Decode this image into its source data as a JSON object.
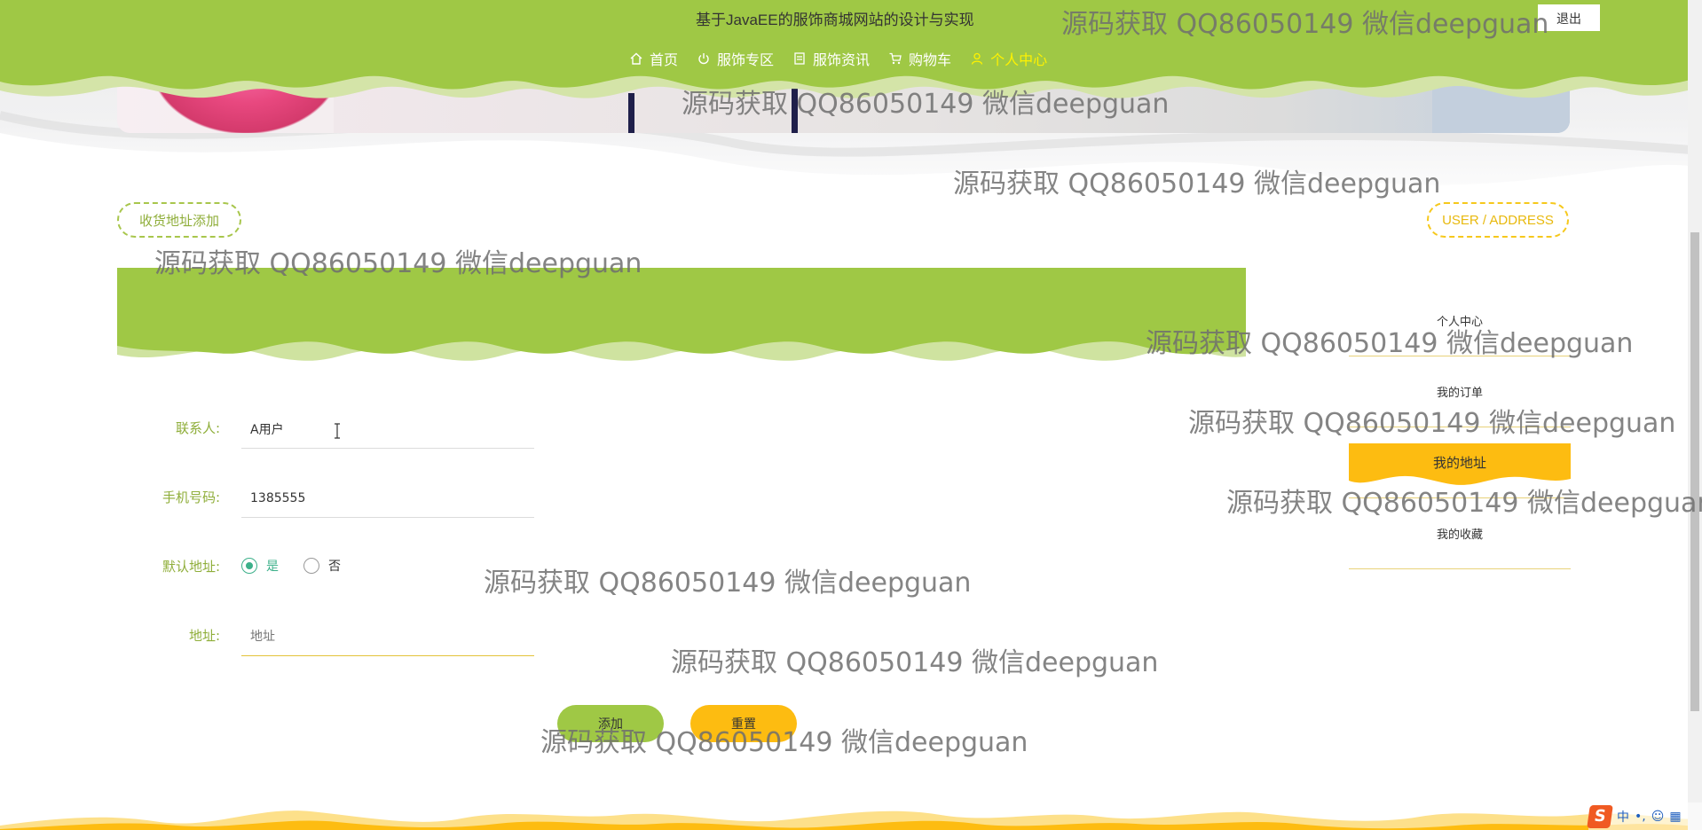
{
  "header": {
    "site_title": "基于JavaEE的服饰商城网站的设计与实现",
    "logout_label": "退出",
    "nav": [
      {
        "label": "首页",
        "icon": "home-icon",
        "active": false
      },
      {
        "label": "服饰专区",
        "icon": "power-icon",
        "active": false
      },
      {
        "label": "服饰资讯",
        "icon": "document-icon",
        "active": false
      },
      {
        "label": "购物车",
        "icon": "cart-icon",
        "active": false
      },
      {
        "label": "个人中心",
        "icon": "user-icon",
        "active": true
      }
    ]
  },
  "section": {
    "title_left": "收货地址添加",
    "title_right": "USER / ADDRESS"
  },
  "form": {
    "contact_label": "联系人:",
    "contact_value": "A用户",
    "phone_label": "手机号码:",
    "phone_value": "1385555",
    "default_label": "默认地址:",
    "default_options": [
      {
        "label": "是",
        "checked": true
      },
      {
        "label": "否",
        "checked": false
      }
    ],
    "address_label": "地址:",
    "address_placeholder": "地址",
    "add_button": "添加",
    "reset_button": "重置"
  },
  "side_menu": {
    "items": [
      {
        "label": "个人中心",
        "active": false
      },
      {
        "label": "我的订单",
        "active": false
      },
      {
        "label": "我的地址",
        "active": true
      },
      {
        "label": "我的收藏",
        "active": false
      }
    ]
  },
  "tray": {
    "ime_logo": "S",
    "ime_text": "中"
  },
  "watermarks": {
    "text": "源码获取 QQ86050149 微信deepguan"
  },
  "colors": {
    "green": "#9fc845",
    "yellow": "#fdbc11",
    "active_nav": "#fff200",
    "radio_checked": "#3cb08a"
  }
}
